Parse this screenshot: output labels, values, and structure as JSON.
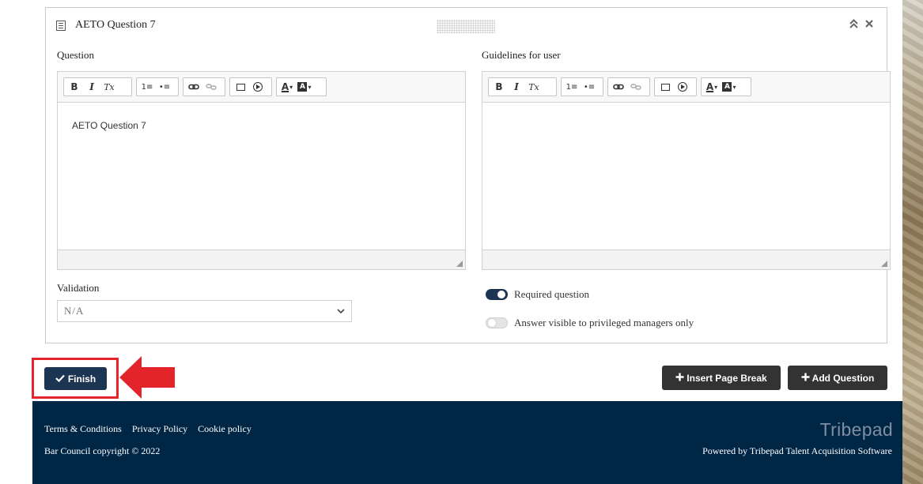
{
  "card": {
    "title": "AETO Question 7"
  },
  "question": {
    "label": "Question",
    "content": "AETO Question 7"
  },
  "guidelines": {
    "label": "Guidelines for user",
    "content": ""
  },
  "toolbar": {
    "bold": "B",
    "italic": "I",
    "remove_format": "Tx",
    "numbered_list": "1≡",
    "bulleted_list": "•≡",
    "text_color": "A",
    "bg_color": "A"
  },
  "validation": {
    "label": "Validation",
    "selected": "N/A"
  },
  "toggles": {
    "required": {
      "label": "Required question",
      "on": true
    },
    "privileged": {
      "label": "Answer visible to privileged managers only",
      "on": false
    }
  },
  "actions": {
    "finish": "Finish",
    "insert_page_break": "Insert Page Break",
    "add_question": "Add Question"
  },
  "footer": {
    "links": [
      "Terms & Conditions",
      "Privacy Policy",
      "Cookie policy"
    ],
    "copyright": "Bar Council copyright © 2022",
    "brand": "Tribepad",
    "powered": "Powered by Tribepad Talent Acquisition Software"
  },
  "colors": {
    "navy": "#1c3553",
    "footer_bg": "#002646",
    "dark_button": "#333333",
    "highlight": "#e3252b"
  },
  "icons": {
    "card": "document-icon",
    "collapse": "double-chevron-up-icon",
    "close": "close-icon",
    "finish": "check-icon",
    "add": "plus-icon",
    "callout": "arrow-left-icon"
  }
}
